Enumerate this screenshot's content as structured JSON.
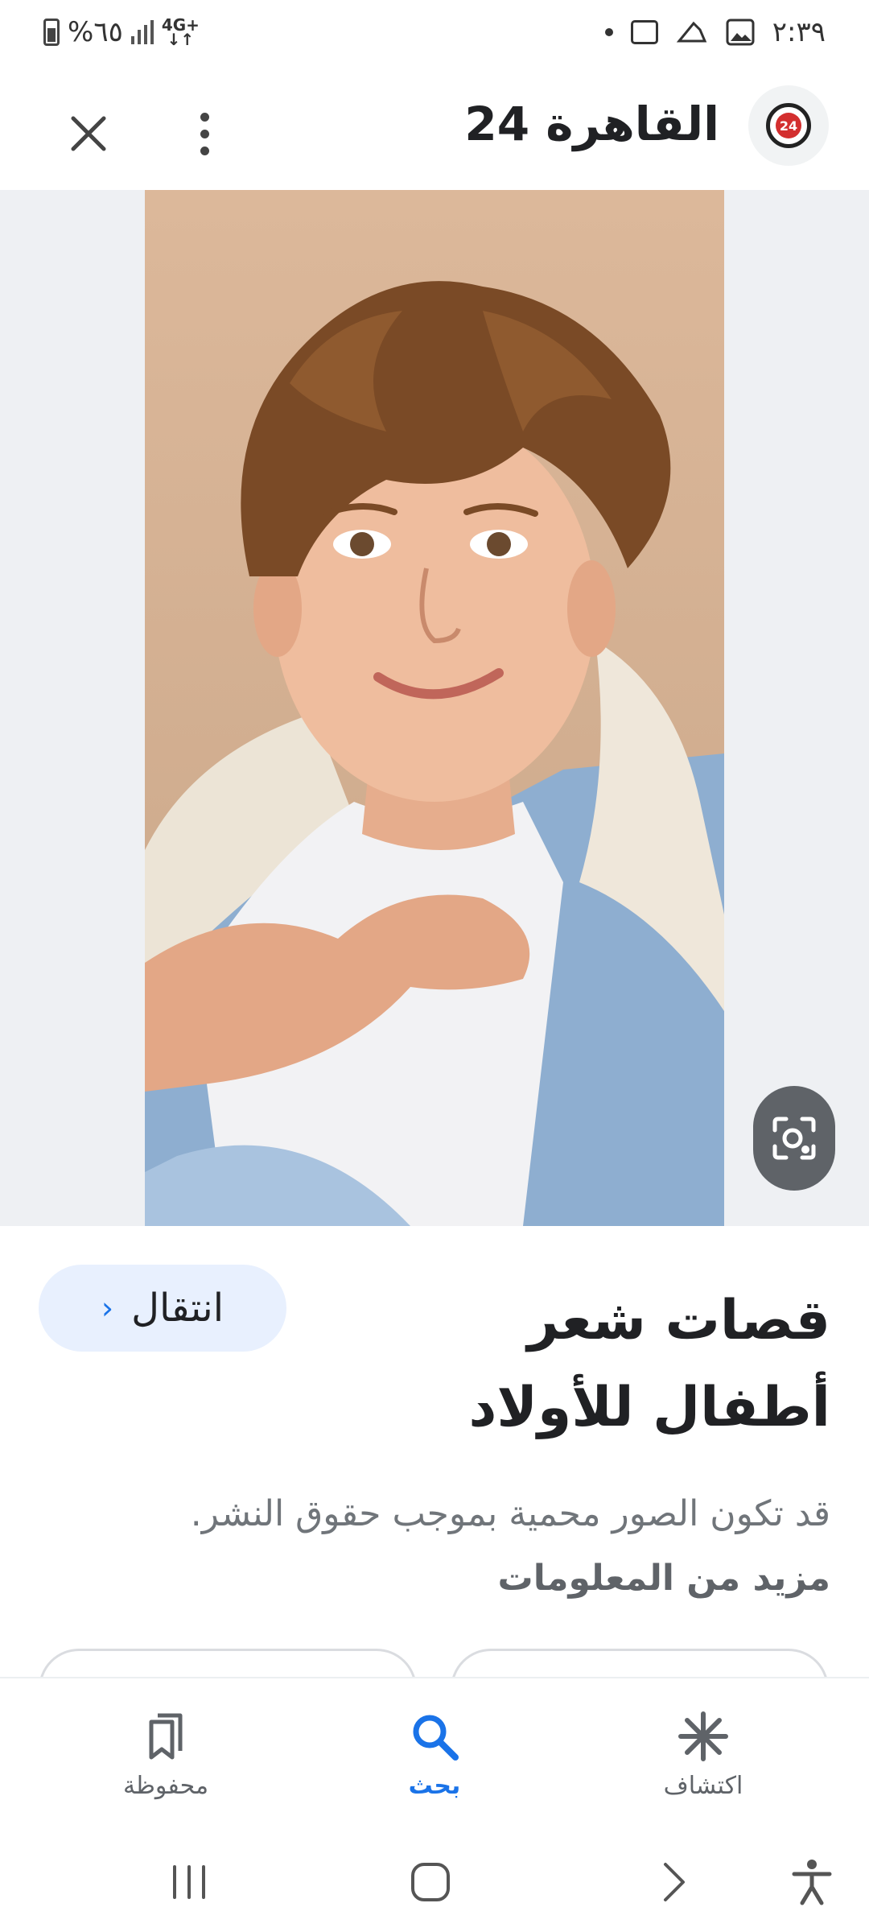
{
  "status_bar": {
    "battery_percent": "%٦٥",
    "network": "4G+",
    "time": "٢:٣٩"
  },
  "header": {
    "site_name": "القاهرة 24",
    "logo_text": "24",
    "icons": {
      "close": "close-icon",
      "more": "more-vert-icon",
      "logo": "site-logo-icon"
    }
  },
  "image": {
    "description_icon": "visual-search-icon"
  },
  "result": {
    "title": "قصات شعر أطفال للأولاد",
    "visit_label": "انتقال",
    "copyright_text": "قد تكون الصور محمية بموجب حقوق النشر.",
    "more_info_label": "مزيد من المعلومات"
  },
  "bottom_nav": {
    "items": [
      {
        "label": "اكتشاف",
        "icon": "asterisk-icon",
        "active": false
      },
      {
        "label": "بحث",
        "icon": "search-icon",
        "active": true
      },
      {
        "label": "محفوظة",
        "icon": "bookmarks-icon",
        "active": false
      }
    ]
  },
  "colors": {
    "accent": "#1a73e8",
    "visit_bg": "#e8f0fe",
    "lens_bg": "#5f6368"
  }
}
